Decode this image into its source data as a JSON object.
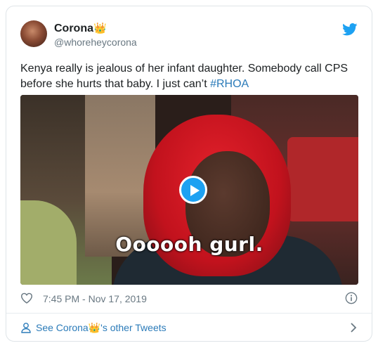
{
  "tweet": {
    "author": {
      "display_name": "Corona",
      "name_emoji": "👑",
      "handle": "@whoreheycorona"
    },
    "text_before": "Kenya really is jealous of her infant daughter. Somebody call CPS before she hurts that baby. I just can’t ",
    "hashtag": "#RHOA",
    "media": {
      "caption": "Oooooh gurl."
    },
    "timestamp": "7:45 PM - Nov 17, 2019"
  },
  "footer": {
    "link_prefix": "See Corona",
    "link_emoji": "👑",
    "link_suffix": "'s other Tweets"
  },
  "icons": {
    "brand": "twitter-bird-icon",
    "like": "heart-icon",
    "info": "info-icon",
    "profile": "person-icon",
    "chevron": "chevron-right-icon",
    "play": "play-icon"
  },
  "colors": {
    "link": "#2b7bb9",
    "twitter_blue": "#1da1f2",
    "meta_gray": "#697882",
    "border": "#dfe4e8"
  }
}
